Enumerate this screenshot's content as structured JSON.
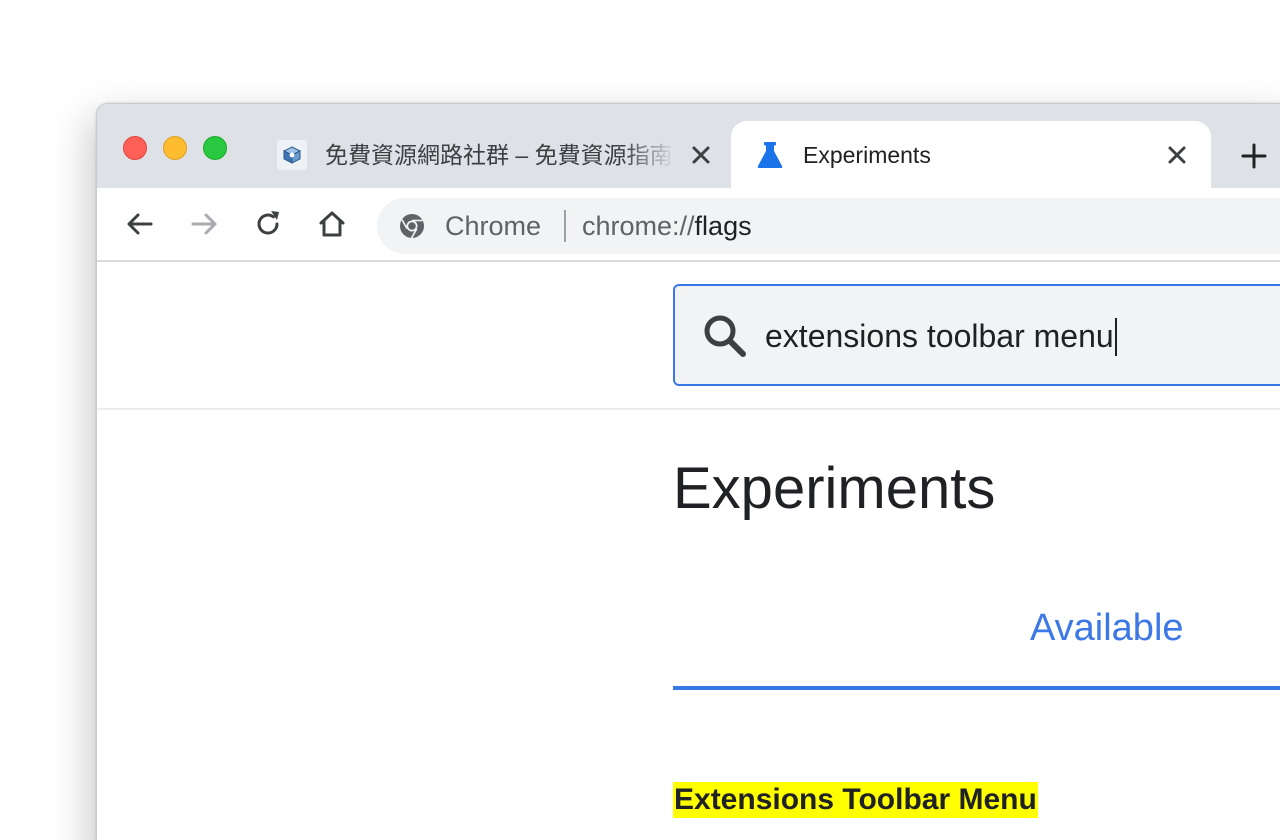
{
  "window": {
    "traffic_lights": {
      "close_color": "#fe5f57",
      "minimize_color": "#febc2e",
      "maximize_color": "#28c840"
    }
  },
  "tabs": [
    {
      "title": "免費資源網路社群 – 免費資源指南",
      "favicon": "cube-logo-icon",
      "active": false
    },
    {
      "title": "Experiments",
      "favicon": "flask-icon",
      "active": true
    }
  ],
  "toolbar": {
    "back_icon": "arrow-left-icon",
    "forward_icon": "arrow-right-icon",
    "reload_icon": "reload-icon",
    "home_icon": "home-icon"
  },
  "omnibox": {
    "chip_label": "Chrome",
    "url_scheme": "chrome://",
    "url_path": "flags"
  },
  "search": {
    "value": "extensions toolbar menu",
    "icon": "search-icon"
  },
  "page": {
    "title": "Experiments",
    "tab_available": "Available"
  },
  "flag": {
    "title": "Extensions Toolbar Menu"
  },
  "colors": {
    "accent": "#3b78e7",
    "highlight": "#ffff00",
    "tabstrip": "#dee1e6",
    "omnibox": "#f1f3f4"
  }
}
